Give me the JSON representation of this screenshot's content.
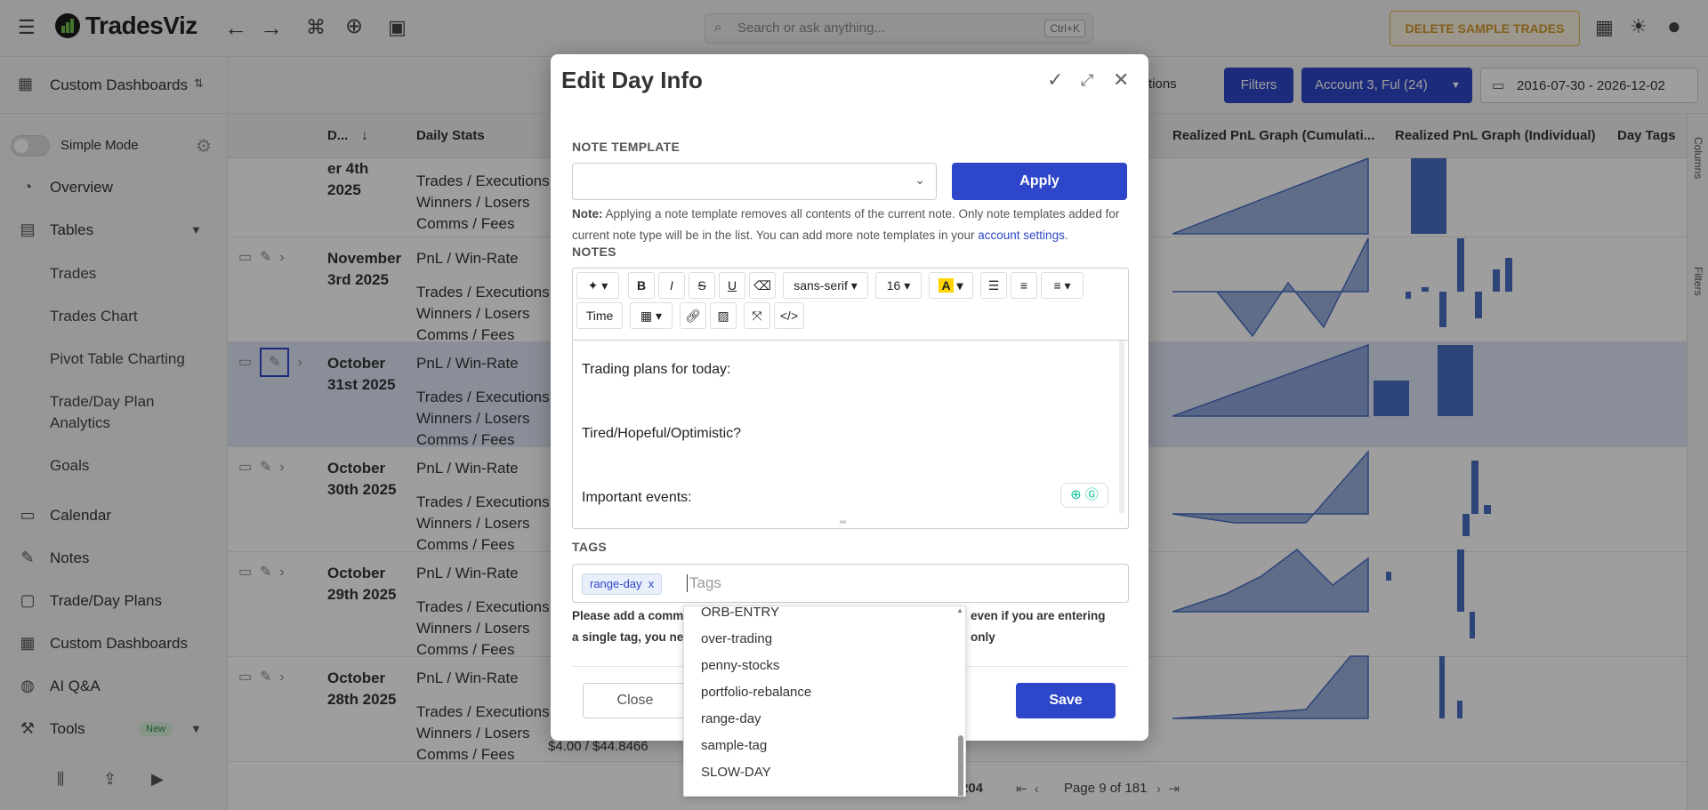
{
  "app": {
    "name": "TradesViz"
  },
  "topbar": {
    "search_placeholder": "Search or ask anything...",
    "search_shortcut": "Ctrl+K",
    "delete_sample": "DELETE SAMPLE TRADES"
  },
  "sidebar": {
    "dashboard_selector": "Custom Dashboards",
    "simple_mode": "Simple Mode",
    "items": [
      {
        "label": "Overview",
        "icon": "overview-icon"
      },
      {
        "label": "Tables",
        "icon": "table-icon"
      },
      {
        "label": "Calendar",
        "icon": "calendar-icon"
      },
      {
        "label": "Notes",
        "icon": "pen-icon"
      },
      {
        "label": "Trade/Day Plans",
        "icon": "clipboard-icon"
      },
      {
        "label": "Custom Dashboards",
        "icon": "dashboard-icon"
      },
      {
        "label": "AI Q&A",
        "icon": "brain-icon"
      },
      {
        "label": "Tools",
        "icon": "wrench-icon",
        "badge": "New"
      }
    ],
    "tables_sub": [
      "Trades",
      "Trades Chart",
      "Pivot Table Charting",
      "Trade/Day Plan Analytics",
      "Goals"
    ]
  },
  "toolbar": {
    "options": "tions",
    "filters": "Filters",
    "account": "Account 3, Ful (24)",
    "date_range": "2016-07-30 - 2026-12-02"
  },
  "table": {
    "headers": [
      "D...",
      "Daily Stats",
      "Realized PnL Graph (Cumulati...",
      "Realized PnL Graph (Individual)",
      "Day Tags"
    ],
    "rows": [
      {
        "date": "er 4th 2025",
        "stats": [
          "Trades / Executions",
          "Winners / Losers",
          "Comms / Fees"
        ]
      },
      {
        "date": "November 3rd 2025",
        "stats": [
          "PnL / Win-Rate",
          "",
          "Trades / Executions",
          "Winners / Losers",
          "Comms / Fees"
        ]
      },
      {
        "date": "October 31st 2025",
        "stats": [
          "PnL / Win-Rate",
          "",
          "Trades / Executions",
          "Winners / Losers",
          "Comms / Fees"
        ]
      },
      {
        "date": "October 30th 2025",
        "stats": [
          "PnL / Win-Rate",
          "",
          "Trades / Executions",
          "Winners / Losers",
          "Comms / Fees"
        ]
      },
      {
        "date": "October 29th 2025",
        "stats": [
          "PnL / Win-Rate",
          "",
          "Trades / Executions",
          "Winners / Losers",
          "Comms / Fees"
        ]
      },
      {
        "date": "October 28th 2025",
        "stats": [
          "PnL / Win-Rate",
          "",
          "Trades / Executions",
          "Winners / Losers",
          "Comms / Fees"
        ]
      }
    ],
    "last_fee": "$4.00 / $44.8466",
    "pagination": "Page 9 of 181",
    "count_fragment": "204",
    "side_tabs": [
      "Columns",
      "Filters"
    ]
  },
  "modal": {
    "title": "Edit Day Info",
    "note_template_label": "NOTE TEMPLATE",
    "apply": "Apply",
    "note_bold": "Note:",
    "note_text": " Applying a note template removes all contents of the current note. Only note templates added for current note type will be in the list. You can add more note templates in your ",
    "note_link": "account settings",
    "note_end": ".",
    "notes_label": "NOTES",
    "editor": {
      "font": "sans-serif",
      "size": "16",
      "time": "Time",
      "lines": [
        "Trading plans for today:",
        "Tired/Hopeful/Optimistic?",
        "Important events:"
      ]
    },
    "tags_label": "TAGS",
    "tag_chip": "range-day",
    "tag_remove": "x",
    "tags_placeholder": "Tags",
    "help_a": "Please add a comma",
    "help_b": "even if you are entering only",
    "help_c": "a single tag, you nee",
    "close": "Close",
    "save": "Save"
  },
  "dropdown": {
    "items": [
      "ORB-ENTRY",
      "over-trading",
      "penny-stocks",
      "portfolio-rebalance",
      "range-day",
      "sample-tag",
      "SLOW-DAY"
    ]
  },
  "colors": {
    "accent": "#2e46c9",
    "chart": "#4a6fc2",
    "warning": "#d19a2b"
  }
}
